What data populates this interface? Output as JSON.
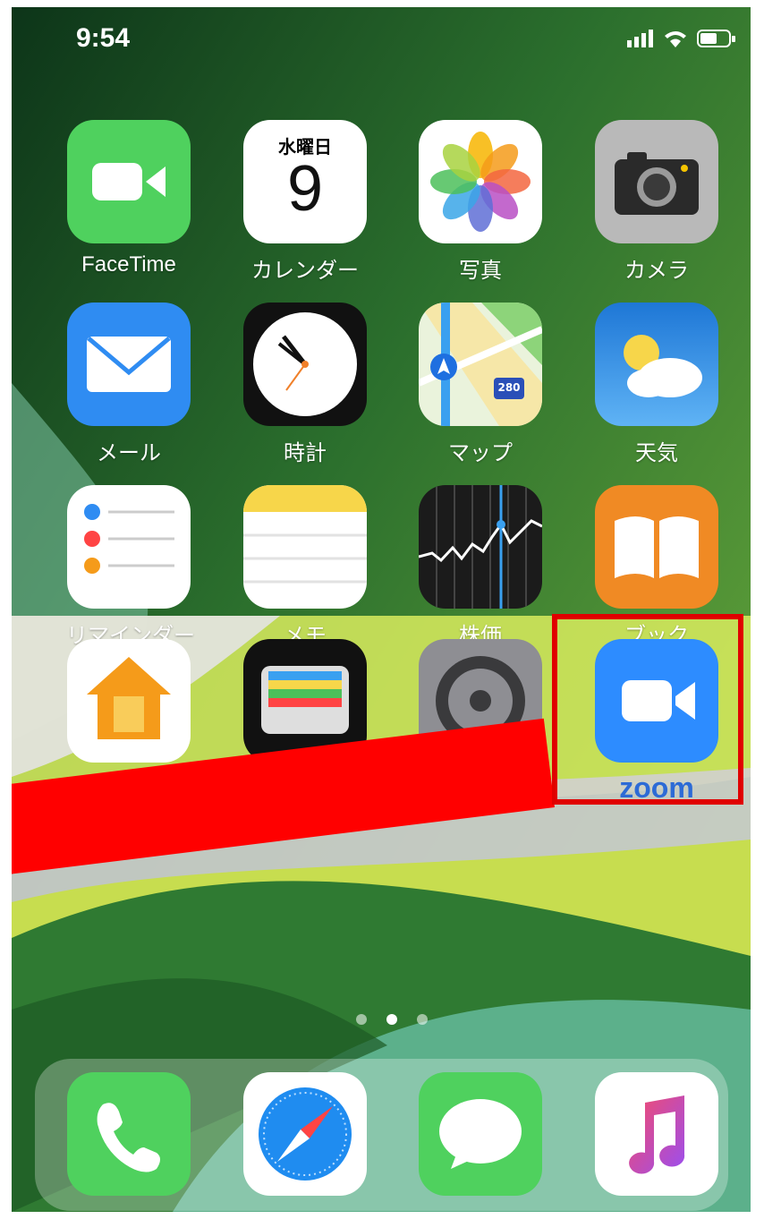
{
  "status_bar": {
    "time": "9:54"
  },
  "calendar": {
    "weekday": "水曜日",
    "day": "9"
  },
  "apps": [
    {
      "label": "FaceTime",
      "icon": "facetime-icon"
    },
    {
      "label": "カレンダー",
      "icon": "calendar-icon"
    },
    {
      "label": "写真",
      "icon": "photos-icon"
    },
    {
      "label": "カメラ",
      "icon": "camera-icon"
    },
    {
      "label": "メール",
      "icon": "mail-icon"
    },
    {
      "label": "時計",
      "icon": "clock-icon"
    },
    {
      "label": "マップ",
      "icon": "maps-icon"
    },
    {
      "label": "天気",
      "icon": "weather-icon"
    },
    {
      "label": "リマインダー",
      "icon": "reminders-icon"
    },
    {
      "label": "メモ",
      "icon": "notes-icon"
    },
    {
      "label": "株価",
      "icon": "stocks-icon"
    },
    {
      "label": "ブック",
      "icon": "books-icon"
    },
    {
      "label": "",
      "icon": "home-icon"
    },
    {
      "label": "",
      "icon": "wallet-icon"
    },
    {
      "label": "",
      "icon": "settings-icon"
    },
    {
      "label": "zoom",
      "icon": "zoom-icon"
    }
  ],
  "maps_badge": "280",
  "dock": [
    {
      "icon": "phone-icon"
    },
    {
      "icon": "safari-icon"
    },
    {
      "icon": "messages-icon"
    },
    {
      "icon": "music-icon"
    }
  ],
  "page_indicator": {
    "pages": 3,
    "current": 2
  },
  "colors": {
    "highlight": "#e00000",
    "arrow": "#ff0000",
    "zoom_blue": "#2d8cff"
  }
}
